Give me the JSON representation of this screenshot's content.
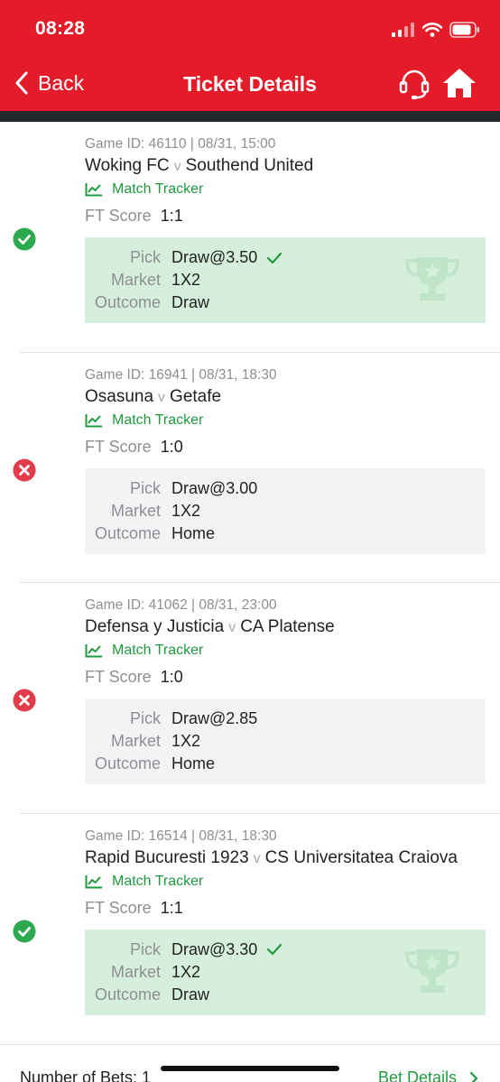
{
  "status_bar": {
    "time": "08:28",
    "icons": [
      "signal-icon",
      "wifi-icon",
      "battery-icon"
    ]
  },
  "nav": {
    "back_label": "Back",
    "title": "Ticket Details",
    "support_icon": "headset-icon",
    "home_icon": "home-icon"
  },
  "colors": {
    "brand": "#e41c2a",
    "win": "#2daa4f",
    "lose": "#e23b4a",
    "link": "#1f9a3e",
    "win_bg": "#d6efdc",
    "lose_bg": "#f2f3f5"
  },
  "labels": {
    "match_tracker": "Match Tracker",
    "ft_score": "FT Score",
    "vs": "v",
    "pick": "Pick",
    "market": "Market",
    "outcome": "Outcome"
  },
  "bets": [
    {
      "status": "won",
      "meta": "Game ID: 46110 | 08/31, 15:00",
      "home": "Woking FC",
      "away": "Southend United",
      "ft_score": "1:1",
      "pick": "Draw@3.50",
      "market": "1X2",
      "outcome": "Draw"
    },
    {
      "status": "lost",
      "meta": "Game ID: 16941 | 08/31, 18:30",
      "home": "Osasuna",
      "away": "Getafe",
      "ft_score": "1:0",
      "pick": "Draw@3.00",
      "market": "1X2",
      "outcome": "Home"
    },
    {
      "status": "lost",
      "meta": "Game ID: 41062 | 08/31, 23:00",
      "home": "Defensa y Justicia",
      "away": "CA Platense",
      "ft_score": "1:0",
      "pick": "Draw@2.85",
      "market": "1X2",
      "outcome": "Home"
    },
    {
      "status": "won",
      "meta": "Game ID: 16514 | 08/31, 18:30",
      "home": "Rapid Bucuresti 1923",
      "away": "CS Universitatea Craiova",
      "ft_score": "1:1",
      "pick": "Draw@3.30",
      "market": "1X2",
      "outcome": "Draw"
    }
  ],
  "footer": {
    "count_label": "Number of Bets: 1",
    "details_label": "Bet Details"
  }
}
